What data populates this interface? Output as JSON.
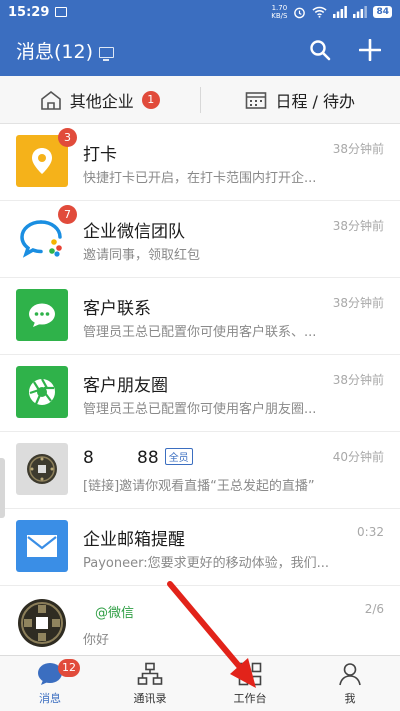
{
  "status_bar": {
    "time": "15:29",
    "net_speed_top": "1.70",
    "net_speed_bottom": "KB/S",
    "battery": "84"
  },
  "header": {
    "title": "消息(12)",
    "search_icon": "search-icon",
    "add_icon": "plus-icon"
  },
  "subbar": {
    "left_label": "其他企业",
    "left_badge": "1",
    "right_label": "日程 / 待办"
  },
  "messages": [
    {
      "name": "打卡",
      "preview": "快捷打卡已开启，在打卡范围内打开企...",
      "time": "38分钟前",
      "badge": "3",
      "color": "#f5b21a",
      "icon": "location-pin-icon"
    },
    {
      "name": "企业微信团队",
      "preview": "邀请同事，领取红包",
      "time": "38分钟前",
      "badge": "7",
      "color": "#ffffff",
      "icon": "chat-bubble-icon"
    },
    {
      "name": "客户联系",
      "preview": "管理员王总已配置你可使用客户联系、...",
      "time": "38分钟前",
      "badge": "",
      "color": "#2fb24a",
      "icon": "chat-icon"
    },
    {
      "name": "客户朋友圈",
      "preview": "管理员王总已配置你可使用客户朋友圈...",
      "time": "38分钟前",
      "badge": "",
      "color": "#2fb24a",
      "icon": "aperture-icon"
    },
    {
      "name": "8        88",
      "tag": "全员",
      "preview": "[链接]邀请你观看直播“王总发起的直播”",
      "time": "40分钟前",
      "badge": "",
      "color": "#dcdcdc",
      "icon": "coin-icon"
    },
    {
      "name": "企业邮箱提醒",
      "preview": "Payoneer:您要求更好的移动体验，我们...",
      "time": "0:32",
      "badge": "",
      "color": "#3a8ee6",
      "icon": "mail-icon"
    },
    {
      "name": "",
      "wechat": "@微信",
      "preview": "你好",
      "time": "2/6",
      "badge": "",
      "color": "#ffffff",
      "icon": "coin-icon"
    }
  ],
  "tabbar": {
    "tabs": [
      {
        "label": "消息",
        "badge": "12",
        "icon": "message-icon"
      },
      {
        "label": "通讯录",
        "icon": "org-chart-icon"
      },
      {
        "label": "工作台",
        "icon": "grid-icon"
      },
      {
        "label": "我",
        "icon": "person-icon"
      }
    ]
  },
  "colors": {
    "brand": "#3b6ec0",
    "badge": "#e14b3b",
    "annotation_arrow": "#e2231a"
  }
}
